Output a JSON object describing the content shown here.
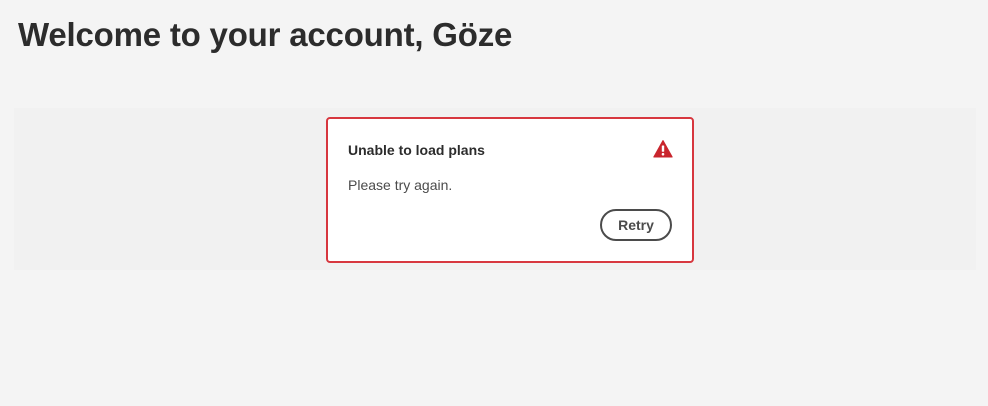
{
  "page": {
    "title": "Welcome to your account, Göze"
  },
  "error_card": {
    "heading": "Unable to load plans",
    "message": "Please try again.",
    "retry_label": "Retry",
    "icon": "alert-icon"
  },
  "colors": {
    "background": "#f4f4f4",
    "panel": "#f1f1f1",
    "error_border": "#d7373f",
    "alert_icon": "#c9252d",
    "text": "#2c2c2c",
    "button_border": "#4b4b4b"
  }
}
